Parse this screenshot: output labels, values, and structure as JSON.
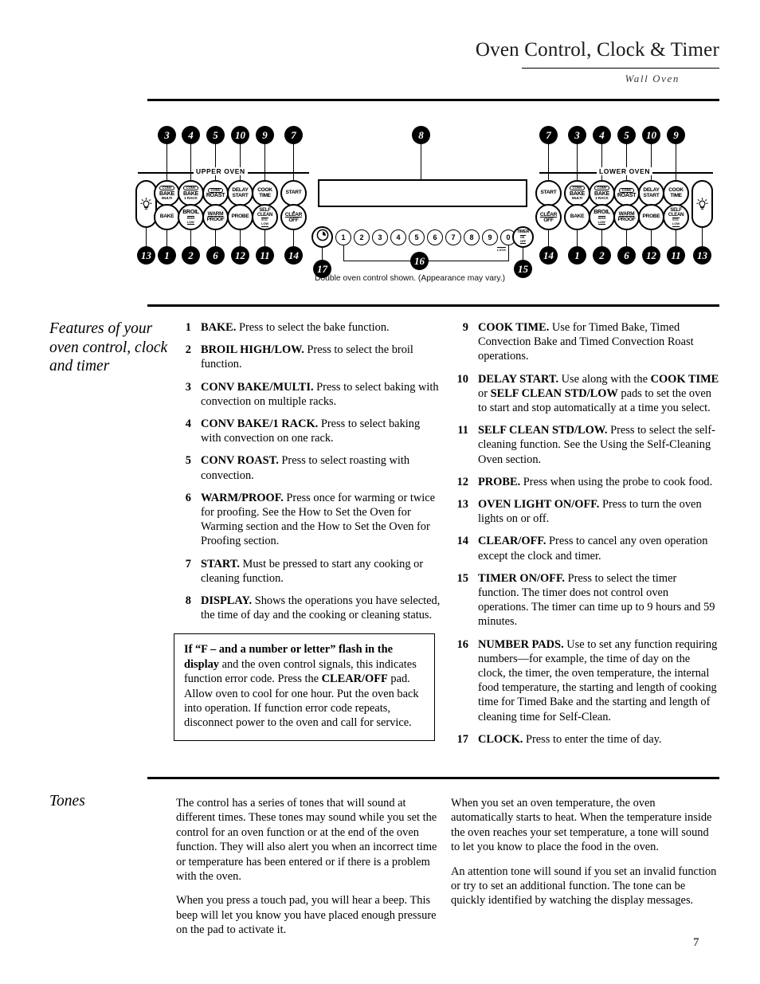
{
  "header": {
    "title": "Oven Control, Clock & Timer",
    "subtitle": "Wall Oven"
  },
  "diagram": {
    "upper_oven_label": "UPPER OVEN",
    "lower_oven_label": "LOWER OVEN",
    "caption": "Double oven control shown. (Appearance may vary.)",
    "lock_label": "LOCK",
    "pads": {
      "conv_bake_multi": {
        "l1": "CONV",
        "l2": "BAKE",
        "l3": "MULTI"
      },
      "conv_bake_1rack": {
        "l1": "CONV",
        "l2": "BAKE",
        "l3": "1 RACK"
      },
      "conv_roast": {
        "l1": "CONV",
        "l2": "ROAST"
      },
      "delay_start": {
        "l1": "DELAY",
        "l2": "START"
      },
      "cook_time": {
        "l1": "COOK",
        "l2": "TIME"
      },
      "start": {
        "l1": "START"
      },
      "bake": {
        "l1": "BAKE"
      },
      "broil_hi_low": {
        "l1": "BROIL",
        "l2": "HIGH",
        "l3": "LOW"
      },
      "warm_proof": {
        "l1": "WARM",
        "l2": "PROOF"
      },
      "probe": {
        "l1": "PROBE"
      },
      "self_clean": {
        "l1": "SELF",
        "l2": "CLEAN",
        "l3": "STD",
        "l4": "LOW"
      },
      "clear_off": {
        "l1": "CLEAR",
        "l2": "OFF"
      },
      "timer": {
        "l1": "TIMER",
        "l2": "ON",
        "l3": "OFF"
      }
    },
    "number_pads": [
      "1",
      "2",
      "3",
      "4",
      "5",
      "6",
      "7",
      "8",
      "9",
      "0"
    ],
    "callouts_upper_top": [
      "3",
      "4",
      "5",
      "10",
      "9",
      "7"
    ],
    "callouts_upper_bottom": [
      "13",
      "1",
      "2",
      "6",
      "12",
      "11",
      "14"
    ],
    "callouts_lower_top": [
      "7",
      "3",
      "4",
      "5",
      "10",
      "9"
    ],
    "callouts_lower_bottom": [
      "14",
      "1",
      "2",
      "6",
      "12",
      "11",
      "13"
    ],
    "callout_display": "8",
    "callout_clock": "17",
    "callout_numbers": "16",
    "callout_timer": "15"
  },
  "features": {
    "heading": "Features of your oven control, clock and timer",
    "left_items": [
      {
        "num": "1",
        "title": "BAKE.",
        "text": " Press to select the bake function."
      },
      {
        "num": "2",
        "title": "BROIL HIGH/LOW.",
        "text": " Press to select the broil function."
      },
      {
        "num": "3",
        "title": "CONV BAKE/MULTI.",
        "text": " Press to select baking with convection on multiple racks."
      },
      {
        "num": "4",
        "title": "CONV BAKE/1 RACK.",
        "text": " Press to select baking with convection on one rack."
      },
      {
        "num": "5",
        "title": "CONV ROAST.",
        "text": " Press to select roasting with convection."
      },
      {
        "num": "6",
        "title": "WARM/PROOF.",
        "text": " Press once for warming or twice for proofing. See the How to Set the Oven for Warming section and the How to Set the Oven for Proofing section."
      },
      {
        "num": "7",
        "title": "START.",
        "text": " Must be pressed to start any cooking or cleaning function."
      },
      {
        "num": "8",
        "title": "DISPLAY.",
        "text": " Shows the operations you have selected, the time of day and the cooking or cleaning status."
      }
    ],
    "right_items": [
      {
        "num": "9",
        "title": "COOK TIME.",
        "text": " Use for Timed Bake, Timed Convection Bake and Timed Convection Roast operations."
      },
      {
        "num": "10",
        "title": "DELAY START.",
        "text": " Use along with the ",
        "bold2": "COOK TIME",
        "text2": " or ",
        "bold3": "SELF CLEAN STD/LOW",
        "text3": " pads to set the oven to start and stop automatically at a time you select."
      },
      {
        "num": "11",
        "title": "SELF CLEAN STD/LOW.",
        "text": " Press to select the self-cleaning function. See the Using the Self-Cleaning Oven section."
      },
      {
        "num": "12",
        "title": "PROBE.",
        "text": " Press when using the probe to cook food."
      },
      {
        "num": "13",
        "title": "OVEN LIGHT ON/OFF.",
        "text": " Press to turn the oven lights on or off."
      },
      {
        "num": "14",
        "title": "CLEAR/OFF.",
        "text": " Press to cancel any oven operation except the clock and timer."
      },
      {
        "num": "15",
        "title": "TIMER ON/OFF.",
        "text": " Press to select the timer function. The timer does not control oven operations. The timer can time up to 9 hours and 59 minutes."
      },
      {
        "num": "16",
        "title": "NUMBER PADS.",
        "text": " Use to set any function requiring numbers—for example, the time of day on the clock, the timer, the oven temperature, the internal food temperature, the starting and length of cooking time for Timed Bake and the starting and length of cleaning time for Self-Clean."
      },
      {
        "num": "17",
        "title": "CLOCK.",
        "text": " Press to enter the time of day."
      }
    ],
    "note": {
      "bold1": "If “F – and a number or letter” flash in the display",
      "text1": " and the oven control signals, this indicates function error code. Press the ",
      "bold2": "CLEAR/OFF",
      "text2": " pad. Allow oven to cool for one hour. Put the oven back into operation. If function error code repeats, disconnect power to the oven and call for service."
    }
  },
  "tones": {
    "heading": "Tones",
    "left_paragraphs": [
      "The control has a series of tones that will sound at different times. These tones may sound while you set the control for an oven function or at the end of the oven function. They will also alert you when an incorrect time or temperature has been entered or if there is a problem with the oven.",
      "When you press a touch pad, you will hear a beep. This beep will let you know you have placed enough pressure on the pad to activate it."
    ],
    "right_paragraphs": [
      "When you set an oven temperature, the oven automatically starts to heat. When the temperature inside the oven reaches your set temperature, a tone will sound to let you know to place the food in the oven.",
      "An attention tone will sound if you set an invalid function or try to set an additional function. The tone can be quickly identified by watching the display messages."
    ]
  },
  "footer": {
    "page_number": "7"
  }
}
